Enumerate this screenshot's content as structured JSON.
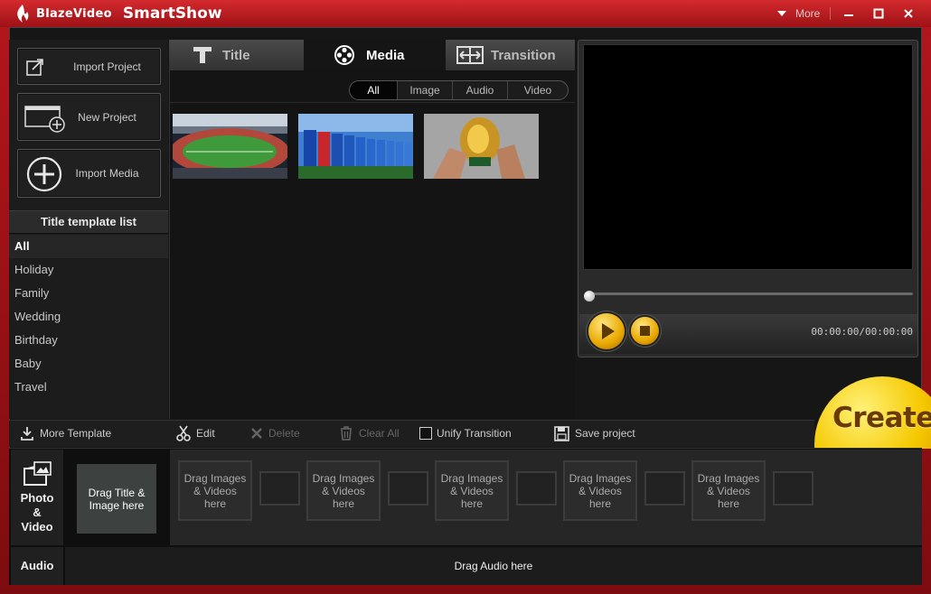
{
  "window": {
    "brand": "BlazeVideo",
    "app_name": "SmartShow",
    "more_label": "More"
  },
  "left": {
    "import_project": "Import  Project",
    "new_project": "New Project",
    "import_media": "Import Media",
    "template_list_title": "Title template list",
    "templates": [
      "All",
      "Holiday",
      "Family",
      "Wedding",
      "Birthday",
      "Baby",
      "Travel"
    ]
  },
  "tabs": {
    "title": "Title",
    "media": "Media",
    "transition": "Transition"
  },
  "filters": [
    "All",
    "Image",
    "Audio",
    "Video"
  ],
  "media_thumbnails": [
    "stadium-aerial",
    "team-lineup",
    "trophy-celebration"
  ],
  "preview": {
    "timecode": "00:00:00/00:00:00"
  },
  "create_label": "Create",
  "toolbar": {
    "more_template": "More Template",
    "edit": "Edit",
    "delete": "Delete",
    "clear_all": "Clear All",
    "unify_transition": "Unify Transition",
    "save_project": "Save project"
  },
  "timeline": {
    "photo_video_label": "Photo\n&\nVideo",
    "audio_label": "Audio",
    "title_drop": "Drag Title &\nImage here",
    "clip_drop": "Drag Images\n& Videos\nhere",
    "audio_drop": "Drag Audio here"
  },
  "colors": {
    "accent_red": "#b4161c",
    "create_yellow": "#f5c800"
  }
}
